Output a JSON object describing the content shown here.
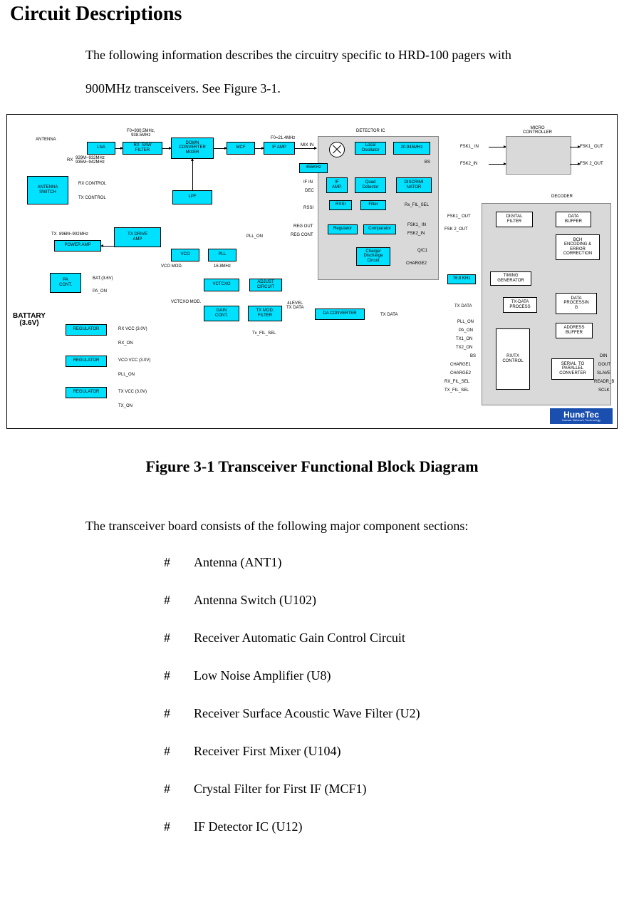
{
  "title": "Circuit Descriptions",
  "intro_line1": "The following information describes the circuitry specific to HRD-100 pagers with",
  "intro_line2": "900MHz transceivers. See Figure 3-1.",
  "figure_caption": "Figure 3-1 Transceiver Functional Block Diagram",
  "list_intro": "The transceiver board consists of the following major component sections:",
  "hash": "#",
  "components": [
    "Antenna (ANT1)",
    "Antenna Switch (U102)",
    "Receiver Automatic Gain Control Circuit",
    "Low Noise Amplifier (U8)",
    "Receiver Surface Acoustic Wave Filter (U2)",
    "Receiver First Mixer (U104)",
    "Crystal Filter for First IF (MCF1)",
    "IF Detector IC (U12)"
  ],
  "diagram": {
    "antenna": "ANTENNA",
    "battery": "BATTARY\n(3.6V)",
    "fo1": "F0=930.5MHz,\n938.5MHz",
    "fo2": "F0=21.4MHz",
    "rx_range": "929M~932MHz\n935M~942MHz",
    "rx_prefix": "RX",
    "tx_range": "896M~902MHz",
    "tx_prefix": "TX",
    "rx_control": "RX CONTROL",
    "tx_control": "TX CONTROL",
    "lna": "LNA",
    "saw": "RX  SAW\nFILTER",
    "dcm": "DOWN\nCONVERTER\nMIXER",
    "mcf": "MCF",
    "ifamp_hdr": "IF AMP",
    "ant_sw": "ANTENNA\nSWITCH",
    "lpf": "LPF",
    "tx_drive": "TX DRIVE\nAMP",
    "power_amp": "POWER AMP",
    "pa_cont": "PA\nCONT.",
    "bat": "BAT.(3.6V)",
    "pa_on": "PA_ON",
    "vco": "VCO",
    "pll": "PLL",
    "pll_on": "PLL_ON",
    "freq_168": "16.8MHz",
    "vco_mod": "VCO MOD.",
    "vctcxo": "VCTCXO",
    "vctcxo_mod": "VCTCXO MOD.",
    "adjust": "ADJUST\nCIRCUIT",
    "gain_cont": "GAIN\nCONT.",
    "tx_mod": "TX MOD.\nFILTER",
    "da_conv": "DA CONVERTER",
    "four_level": "4LEVEL\nTX DATA",
    "tx_fil_sel": "Tx_FIL_SEL",
    "tx_data": "TX DATA",
    "regulator": "REGULATOR",
    "rx_vcc": "RX VCC (3.0V)",
    "rx_on": "RX_ON",
    "vco_vcc": "VCO VCC (3.0V)",
    "pll_on2": "PLL_ON",
    "tx_vcc": "TX VCC (3.0V)",
    "tx_on": "TX_ON",
    "detector_ic": "DETECTOR IC",
    "mix_in": "MIX IN",
    "local_osc": "Local\nOscillator",
    "freq_20945": "20.945MHz",
    "bs": "BS",
    "f455": "455KHz",
    "if_in": "IF IN",
    "dec": "DEC",
    "rssi_sig": "RSSI",
    "ifamp": "IF\nAMP.",
    "quad_det": "Quad\nDetector",
    "discrim": "DISCRIMI\nNATOR",
    "rssi": "RSSI",
    "filter": "Filter",
    "rx_fil_sel": "Rx_FIL_SEL",
    "reg_out": "REG OUT",
    "reg_cont": "REG CONT",
    "regulator_blk": "Regulator",
    "comparator": "Comparator",
    "fsk1_in": "FSK1_ IN",
    "fsk2_in": "FSK2_IN",
    "charge_circuit": "Charge/\nDischarge\nCircuit",
    "qc1": "Q/C1",
    "charge2": "CHARGE2",
    "micro_controller": "MICRO\nCONTROLLER",
    "fsk1_in2": "FSK1_ IN",
    "fsk2_in2": "FSK2_IN",
    "fsk1_out": "FSK1_ OUT",
    "fsk2_out": "FSK 2_OUT",
    "decoder": "DECODER",
    "fsk1_out2": "FSK1_ OUT",
    "fsk2_out2": "FSK 2_OUT",
    "digital_filter": "DIGITAL\nFILTER",
    "data_buffer": "DATA\nBUFFER",
    "bch": "BCH\nENCODING &\nERROR\nCORRECTION",
    "timing_gen": "TIMING\nGENERATOR",
    "freq_768": "76.8 KHz",
    "txdata_proc": "TX-DATA\nPROCESS",
    "data_proc": "DATA\nPROCESSIN\nG",
    "addr_buf": "ADDRESS\nBUFFER",
    "rxtx_ctrl": "RX/TX\nCONTROL",
    "ser_par": "SERIAL  TO\nPARALLEL\nCONVERTER",
    "dec_tx_data": "TX DATA",
    "dec_pll_on": "PLL_ON",
    "dec_pa_on": "PA_ON",
    "dec_tx1_on": "TX1_ON",
    "dec_tx2_on": "TX2_ON",
    "dec_bs": "BS",
    "dec_charge1": "CHARGE1",
    "dec_charge2": "CHARGE2",
    "dec_rx_fil_sel": "RX_FIL_SEL",
    "dec_tx_fil_sel": "TX_FIL_SEL",
    "din": "DIN",
    "dout": "DOUT",
    "slave": "SLAVE",
    "readr_b": "READR_B",
    "sclk": "SCLK",
    "hunetec": "HuneTec",
    "hunetec_sub": "Human Network Technology"
  }
}
